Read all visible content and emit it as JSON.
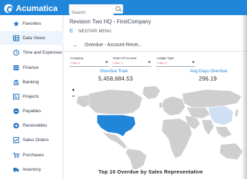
{
  "app": {
    "brand": "Acumatica"
  },
  "search": {
    "placeholder": "Search"
  },
  "sidebar": {
    "items": [
      {
        "label": "Favorites",
        "icon": "star-icon"
      },
      {
        "label": "Data Views",
        "icon": "table-icon"
      },
      {
        "label": "Time and Expenses",
        "icon": "clock-icon"
      },
      {
        "label": "Finance",
        "icon": "finance-icon"
      },
      {
        "label": "Banking",
        "icon": "bank-icon"
      },
      {
        "label": "Projects",
        "icon": "projects-icon"
      },
      {
        "label": "Payables",
        "icon": "minus-circle-icon"
      },
      {
        "label": "Receivables",
        "icon": "plus-circle-icon"
      },
      {
        "label": "Sales Orders",
        "icon": "sales-orders-icon"
      },
      {
        "label": "Purchases",
        "icon": "cart-icon"
      },
      {
        "label": "Inventory",
        "icon": "truck-icon"
      }
    ]
  },
  "header": {
    "company": "Revision Two HQ  -  FirstCompany",
    "breadcrumb": "NEOTARI MENU",
    "page_title": "Overdue - Account Recei..."
  },
  "filters": [
    {
      "label": "Company",
      "value": "< ALL >"
    },
    {
      "label": "Chart Of Account",
      "value": "< ALL >"
    },
    {
      "label": "Ledger Type",
      "value": "< ALL >"
    }
  ],
  "kpis": [
    {
      "label": "Overdue Total",
      "value": "5,458,684.53"
    },
    {
      "label": "Avg Days Overdue",
      "value": "296.19"
    }
  ],
  "map": {
    "zoom_in": "+",
    "zoom_out": "−",
    "colors": {
      "highlight": "#1f86d9",
      "light": "#cfe0f5",
      "land": "#cfcfcf"
    }
  },
  "chart": {
    "title": "Top 10 Overdue by Sales Representative"
  }
}
